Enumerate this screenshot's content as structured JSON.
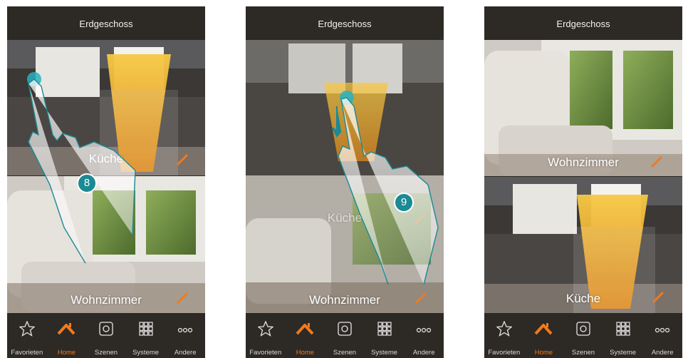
{
  "screens": [
    {
      "header": {
        "title": "Erdgeschoss"
      },
      "rooms": [
        {
          "name": "Küche"
        },
        {
          "name": "Wohnzimmer"
        }
      ],
      "step": "8",
      "nav": [
        "Favorieten",
        "Home",
        "Szenen",
        "Systeme",
        "Andere"
      ]
    },
    {
      "header": {
        "title": "Erdgeschoss"
      },
      "rooms": [
        {
          "name": "Küche"
        },
        {
          "name": "Wohnzimmer"
        }
      ],
      "step": "9",
      "nav": [
        "Favorieten",
        "Home",
        "Szenen",
        "Systeme",
        "Andere"
      ]
    },
    {
      "header": {
        "title": "Erdgeschoss"
      },
      "rooms": [
        {
          "name": "Wohnzimmer"
        },
        {
          "name": "Küche"
        }
      ],
      "nav": [
        "Favorieten",
        "Home",
        "Szenen",
        "Systeme",
        "Andere"
      ]
    }
  ],
  "colors": {
    "accent": "#f07a1e",
    "badge": "#1a8a94",
    "bar": "#2d2925"
  },
  "icons": [
    "star-icon",
    "home-icon",
    "scenes-icon",
    "systems-icon",
    "more-icon",
    "edit-pencil-icon"
  ]
}
